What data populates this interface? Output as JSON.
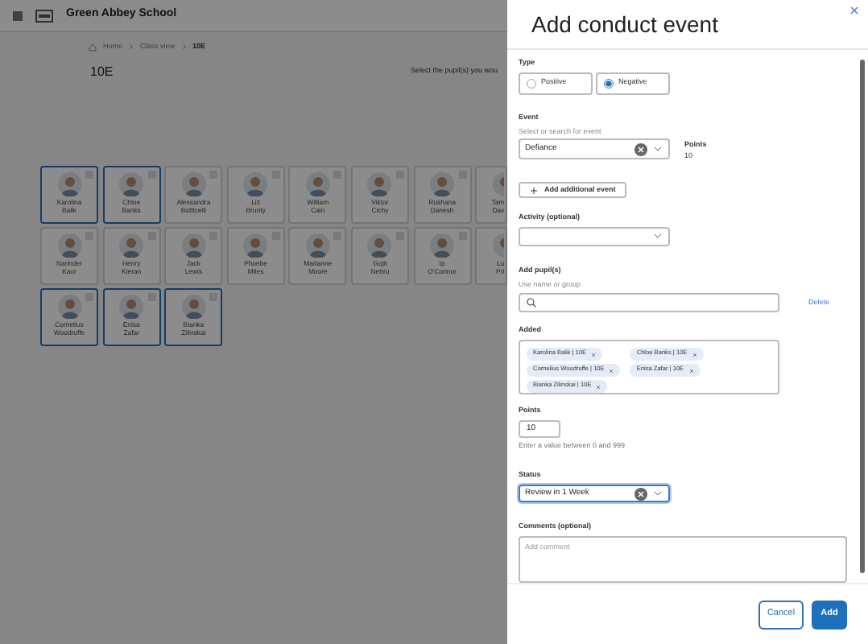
{
  "app": {
    "school_name": "Green Abbey School"
  },
  "breadcrumb": [
    {
      "label": "Home"
    },
    {
      "label": "Class view"
    },
    {
      "label": "10E"
    }
  ],
  "class_title": "10E",
  "instruction": "Select the pupil(s) you wou",
  "pupils": [
    {
      "first": "Karolina",
      "last": "Balik",
      "selected": true,
      "kind": "full"
    },
    {
      "first": "Chloe",
      "last": "Banks",
      "selected": true,
      "kind": "full"
    },
    {
      "first": "Alessandra",
      "last": "Botticelli",
      "selected": false,
      "kind": "full"
    },
    {
      "first": "Liz",
      "last": "Brunty",
      "selected": false,
      "kind": "full"
    },
    {
      "first": "William",
      "last": "Cain",
      "selected": false,
      "kind": "full"
    },
    {
      "first": "Viktor",
      "last": "Cichy",
      "selected": false,
      "kind": "full"
    },
    {
      "first": "Rushana",
      "last": "Danesh",
      "selected": false,
      "kind": "full"
    },
    {
      "first": "Tam",
      "last": "Dav",
      "selected": false,
      "kind": "partial"
    },
    {
      "first": "Narinder",
      "last": "Kaur",
      "selected": false,
      "kind": "full"
    },
    {
      "first": "Henry",
      "last": "Kieran",
      "selected": false,
      "kind": "full"
    },
    {
      "first": "Jack",
      "last": "Lewis",
      "selected": false,
      "kind": "full"
    },
    {
      "first": "Phoebe",
      "last": "Miles",
      "selected": false,
      "kind": "full"
    },
    {
      "first": "Marianne",
      "last": "Moore",
      "selected": false,
      "kind": "full"
    },
    {
      "first": "Gojit",
      "last": "Nehru",
      "selected": false,
      "kind": "full"
    },
    {
      "first": "Ip",
      "last": "O'Connor",
      "selected": false,
      "kind": "full"
    },
    {
      "first": "Lu",
      "last": "Pri",
      "selected": false,
      "kind": "partial"
    },
    {
      "first": "Cornelius",
      "last": "Woodruffe",
      "selected": true,
      "kind": "full"
    },
    {
      "first": "Enisa",
      "last": "Zafar",
      "selected": true,
      "kind": "full"
    },
    {
      "first": "Bianka",
      "last": "Zilinskai",
      "selected": true,
      "kind": "full"
    }
  ],
  "dialog": {
    "title": "Add conduct event",
    "type": {
      "label": "Type",
      "options": [
        {
          "label": "Positive",
          "selected": false
        },
        {
          "label": "Negative",
          "selected": true
        }
      ]
    },
    "event": {
      "label": "Event",
      "hint": "Select or search for event",
      "value": "Defiance",
      "points_label": "Points",
      "points": "10"
    },
    "add_event_button": "Add additional event",
    "activity": {
      "label": "Activity (optional)"
    },
    "add_pupils": {
      "label": "Add pupil(s)",
      "hint": "Use name or group",
      "delete_link": "Delete",
      "added_label": "Added",
      "chips": [
        {
          "label": "Karolina Balik | 10E"
        },
        {
          "label": "Chloe Banks | 10E"
        },
        {
          "label": "Cornelius Woodruffe | 10E"
        },
        {
          "label": "Enisa Zafar | 10E"
        },
        {
          "label": "Bianka Zilinskai | 10E"
        }
      ]
    },
    "points": {
      "label": "Points",
      "value": "10",
      "hint": "Enter a value between 0 and 999"
    },
    "status": {
      "label": "Status",
      "value": "Review in 1 Week",
      "focused": true
    },
    "comments": {
      "label": "Comments (optional)",
      "placeholder": "Add comment"
    },
    "buttons": {
      "cancel": "Cancel",
      "add": "Add"
    }
  }
}
